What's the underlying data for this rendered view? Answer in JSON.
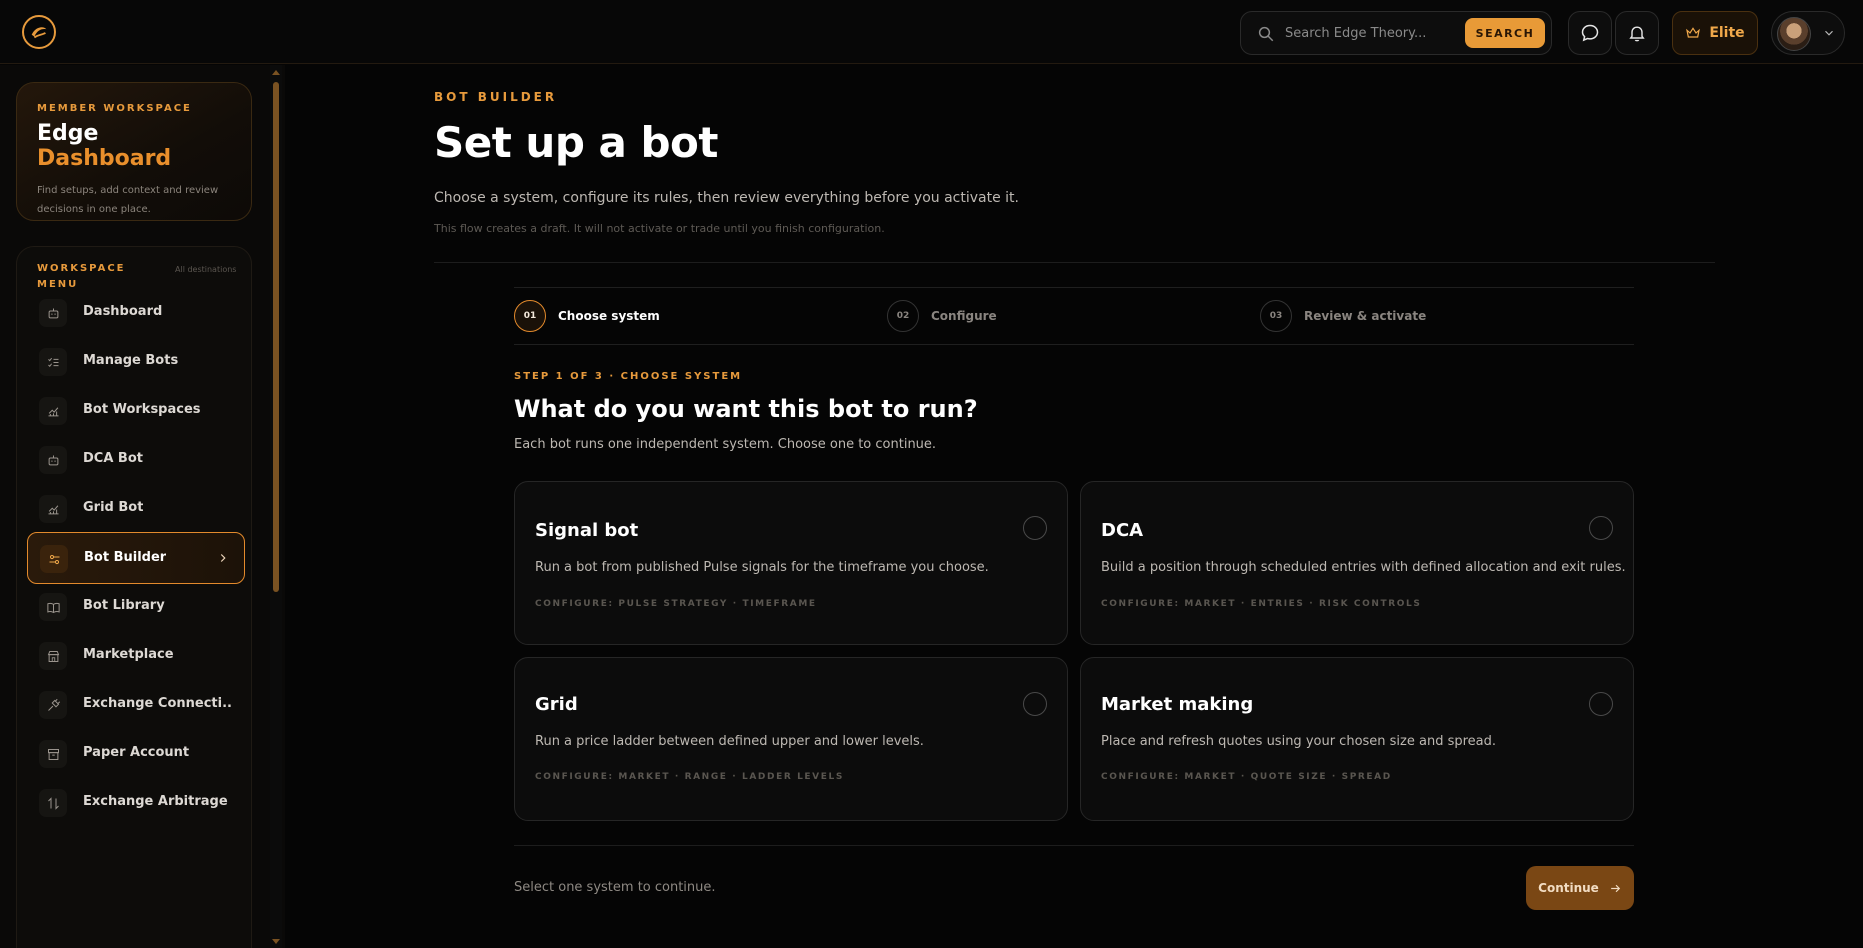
{
  "topbar": {
    "search_placeholder": "Search Edge Theory...",
    "search_button": "SEARCH",
    "plan_label": "Elite"
  },
  "sidebar": {
    "workspace_eyebrow": "MEMBER WORKSPACE",
    "title_part1": "Edge",
    "title_part2": "Dashboard",
    "description": "Find setups, add context and review decisions in one place.",
    "menu_heading": "WORKSPACE MENU",
    "menu_scope": "All destinations",
    "items": [
      {
        "label": "Dashboard",
        "icon": "robot-icon"
      },
      {
        "label": "Manage Bots",
        "icon": "checklist-icon"
      },
      {
        "label": "Bot Workspaces",
        "icon": "chart-icon"
      },
      {
        "label": "DCA Bot",
        "icon": "robot-icon"
      },
      {
        "label": "Grid Bot",
        "icon": "chart-icon"
      },
      {
        "label": "Bot Builder",
        "icon": "sliders-icon",
        "active": true
      },
      {
        "label": "Bot Library",
        "icon": "book-icon"
      },
      {
        "label": "Marketplace",
        "icon": "store-icon"
      },
      {
        "label": "Exchange Connecti...",
        "icon": "plug-icon"
      },
      {
        "label": "Paper Account",
        "icon": "archive-icon"
      },
      {
        "label": "Exchange Arbitrage",
        "icon": "swap-icon"
      }
    ]
  },
  "main": {
    "breadcrumb": "BOT BUILDER",
    "title": "Set up a bot",
    "lead": "Choose a system, configure its rules, then review everything before you activate it.",
    "note": "This flow creates a draft. It will not activate or trade until you finish configuration.",
    "steps": [
      {
        "num": "01",
        "label": "Choose system",
        "active": true
      },
      {
        "num": "02",
        "label": "Configure"
      },
      {
        "num": "03",
        "label": "Review & activate"
      }
    ],
    "step_tag": "STEP 1 OF 3 · CHOOSE SYSTEM",
    "question": "What do you want this bot to run?",
    "subtext": "Each bot runs one independent system. Choose one to continue.",
    "options": [
      {
        "title": "Signal bot",
        "description": "Run a bot from published Pulse signals for the timeframe you choose.",
        "meta": "CONFIGURE: PULSE STRATEGY · TIMEFRAME"
      },
      {
        "title": "DCA",
        "description": "Build a position through scheduled entries with defined allocation and exit rules.",
        "meta": "CONFIGURE: MARKET · ENTRIES · RISK CONTROLS"
      },
      {
        "title": "Grid",
        "description": "Run a price ladder between defined upper and lower levels.",
        "meta": "CONFIGURE: MARKET · RANGE · LADDER LEVELS"
      },
      {
        "title": "Market making",
        "description": "Place and refresh quotes using your chosen size and spread.",
        "meta": "CONFIGURE: MARKET · QUOTE SIZE · SPREAD"
      }
    ],
    "footer_hint": "Select one system to continue.",
    "continue_label": "Continue"
  }
}
